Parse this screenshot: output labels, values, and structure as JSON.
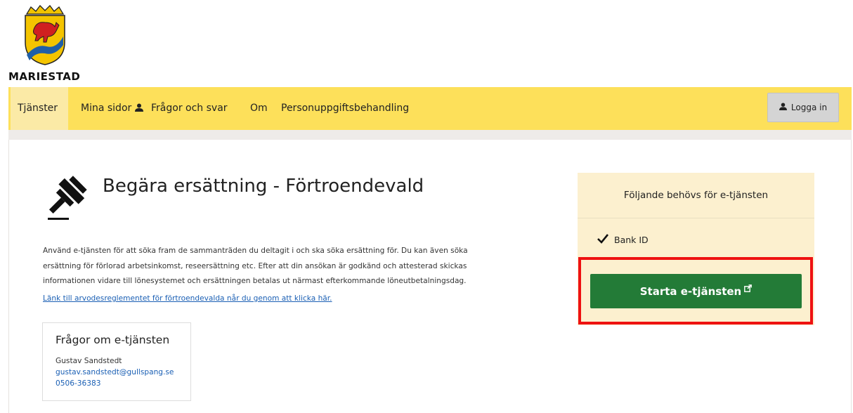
{
  "brand": {
    "name": "MARIESTAD",
    "colors": {
      "nav": "#fde05a",
      "nav_active": "#fbeaa6",
      "primary_button": "#237b37",
      "panel": "#fcf0cf",
      "highlight": "#ee1111",
      "link": "#1a5fb4"
    }
  },
  "nav": {
    "items": [
      {
        "label": "Tjänster",
        "active": true
      },
      {
        "label": "Mina sidor",
        "icon": "user-icon"
      },
      {
        "label": "Frågor och svar"
      },
      {
        "label": "Om"
      },
      {
        "label": "Personuppgiftsbehandling"
      }
    ],
    "login_label": "Logga in",
    "login_icon": "user-icon"
  },
  "service": {
    "icon": "gavel-icon",
    "title": "Begära ersättning - Förtroendevald",
    "description": "Använd e-tjänsten för att söka fram de sammanträden du deltagit i och ska söka ersättning för. Du kan även söka ersättning för förlorad arbetsinkomst, reseersättning etc. Efter att din ansökan är godkänd och attesterad skickas informationen vidare till lönesystemet och ersättningen betalas ut närmast efterkommande löneutbetalningsdag.",
    "rules_link": "Länk till arvodesreglementet för förtroendevalda når du genom att klicka här."
  },
  "contact": {
    "title": "Frågor om e-tjänsten",
    "name": "Gustav Sandstedt",
    "email": "gustav.sandstedt@gullspang.se",
    "phone": "0506-36383"
  },
  "requirements": {
    "heading": "Följande behövs för e-tjänsten",
    "items": [
      {
        "label": "Bank ID",
        "icon": "checkmark-icon"
      }
    ],
    "start_button": "Starta e-tjänsten",
    "start_icon": "external-link-icon"
  }
}
